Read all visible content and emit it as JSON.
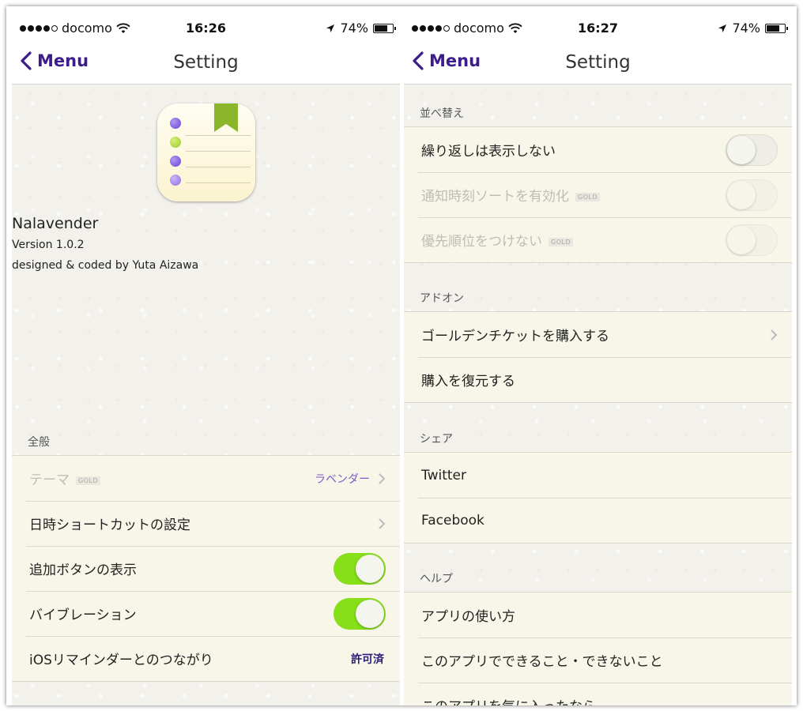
{
  "left": {
    "status": {
      "carrier": "docomo",
      "time": "16:26",
      "battery": "74%"
    },
    "nav": {
      "back": "Menu",
      "title": "Setting"
    },
    "about": {
      "name": "Nalavender",
      "version": "Version 1.0.2",
      "credit": "designed & coded by Yuta Aizawa"
    },
    "sections": {
      "general": {
        "header": "全般",
        "rows": [
          {
            "label": "テーマ",
            "badge": "GOLD",
            "value": "ラベンダー"
          },
          {
            "label": "日時ショートカットの設定"
          },
          {
            "label": "追加ボタンの表示",
            "toggle": "on"
          },
          {
            "label": "バイブレーション",
            "toggle": "on"
          },
          {
            "label": "iOSリマインダーとのつながり",
            "value": "許可済"
          }
        ]
      }
    }
  },
  "right": {
    "status": {
      "carrier": "docomo",
      "time": "16:27",
      "battery": "74%"
    },
    "nav": {
      "back": "Menu",
      "title": "Setting"
    },
    "sections": {
      "sort": {
        "header": "並べ替え",
        "rows": [
          {
            "label": "繰り返しは表示しない",
            "toggle": "off"
          },
          {
            "label": "通知時刻ソートを有効化",
            "badge": "GOLD",
            "toggle": "off"
          },
          {
            "label": "優先順位をつけない",
            "badge": "GOLD",
            "toggle": "off"
          }
        ]
      },
      "addon": {
        "header": "アドオン",
        "rows": [
          {
            "label": "ゴールデンチケットを購入する"
          },
          {
            "label": "購入を復元する"
          }
        ]
      },
      "share": {
        "header": "シェア",
        "rows": [
          {
            "label": "Twitter"
          },
          {
            "label": "Facebook"
          }
        ]
      },
      "help": {
        "header": "ヘルプ",
        "rows": [
          {
            "label": "アプリの使い方"
          },
          {
            "label": "このアプリでできること・できないこと"
          },
          {
            "label": "このアプリを気に入ったなら"
          }
        ]
      }
    }
  },
  "colors": {
    "accent": "#3c1b8a",
    "toggle_on": "#86df19",
    "theme_value": "#7a5bc7"
  },
  "icons": {
    "back": "chevron-left-icon",
    "disclosure": "chevron-right-icon",
    "location": "location-arrow-icon",
    "wifi": "wifi-icon",
    "battery": "battery-icon"
  }
}
